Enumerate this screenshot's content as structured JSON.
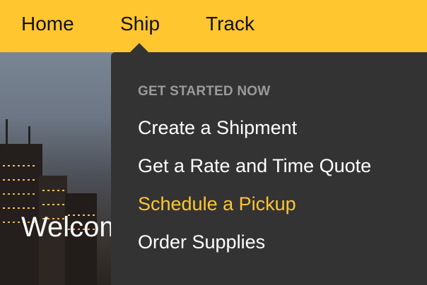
{
  "nav": {
    "items": [
      {
        "label": "Home"
      },
      {
        "label": "Ship"
      },
      {
        "label": "Track"
      }
    ]
  },
  "dropdown": {
    "heading": "GET STARTED NOW",
    "items": [
      {
        "label": "Create a Shipment"
      },
      {
        "label": "Get a Rate and Time Quote"
      },
      {
        "label": "Schedule a Pickup",
        "highlighted": true
      },
      {
        "label": "Order Supplies"
      }
    ]
  },
  "hero": {
    "welcome_text": "Welcome"
  },
  "colors": {
    "brand_yellow": "#ffc62f",
    "dropdown_bg": "#333333",
    "heading_gray": "#9a9a9a"
  }
}
